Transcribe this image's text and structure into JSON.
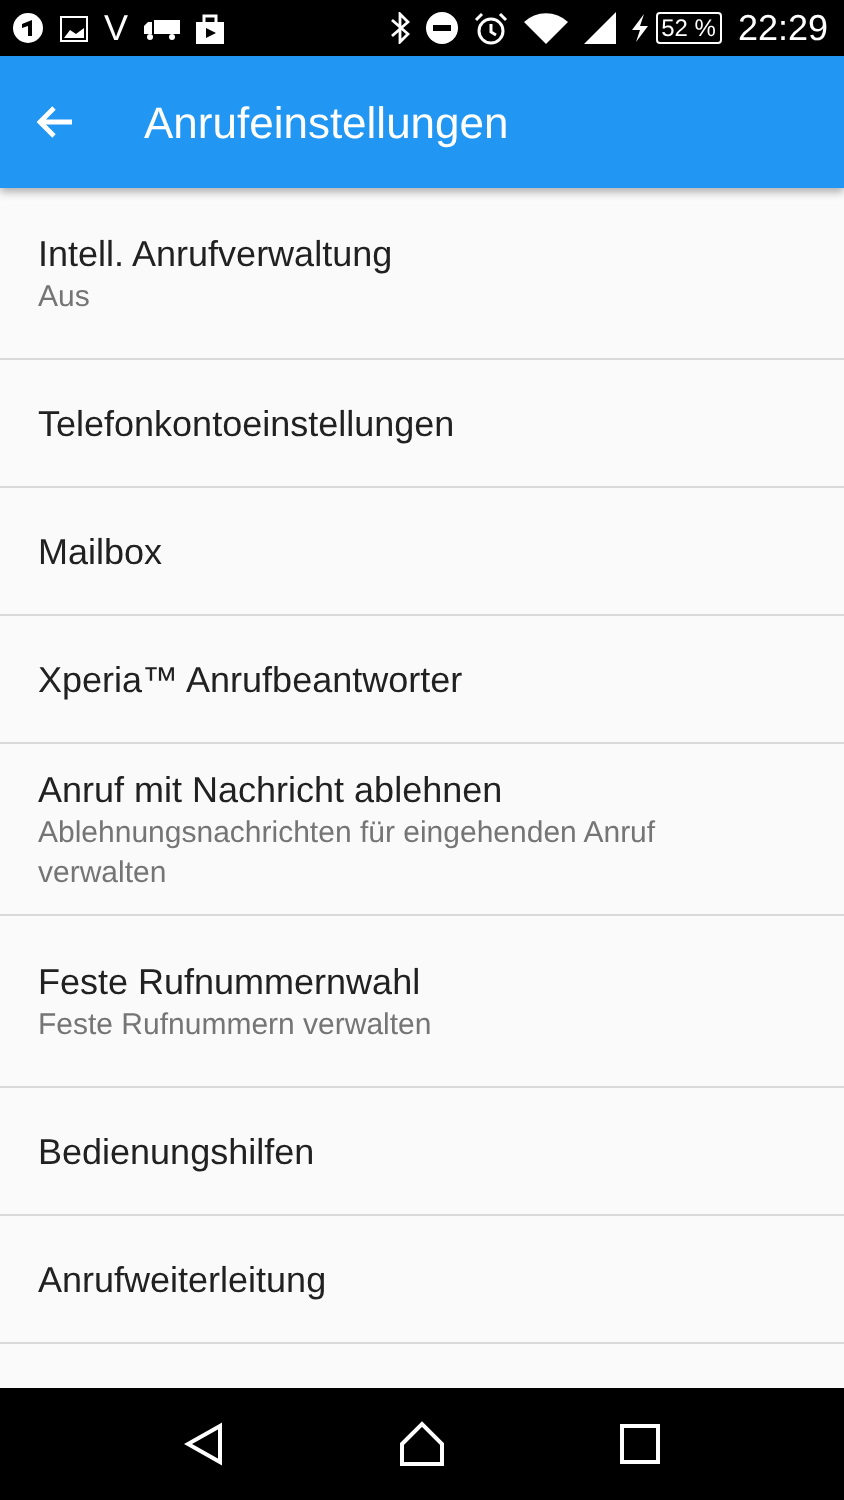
{
  "status_bar": {
    "carrier_letter": "V",
    "battery": "52 %",
    "time": "22:29"
  },
  "app_bar": {
    "title": "Anrufeinstellungen"
  },
  "items": [
    {
      "title": "Intell. Anrufverwaltung",
      "summary": "Aus"
    },
    {
      "title": "Telefonkontoeinstellungen"
    },
    {
      "title": "Mailbox"
    },
    {
      "title": "Xperia™ Anrufbeantworter"
    },
    {
      "title": "Anruf mit Nachricht ablehnen",
      "summary": "Ablehnungsnachrichten für eingehenden Anruf verwalten"
    },
    {
      "title": "Feste Rufnummernwahl",
      "summary": "Feste Rufnummern verwalten"
    },
    {
      "title": "Bedienungshilfen"
    },
    {
      "title": "Anrufweiterleitung"
    }
  ]
}
